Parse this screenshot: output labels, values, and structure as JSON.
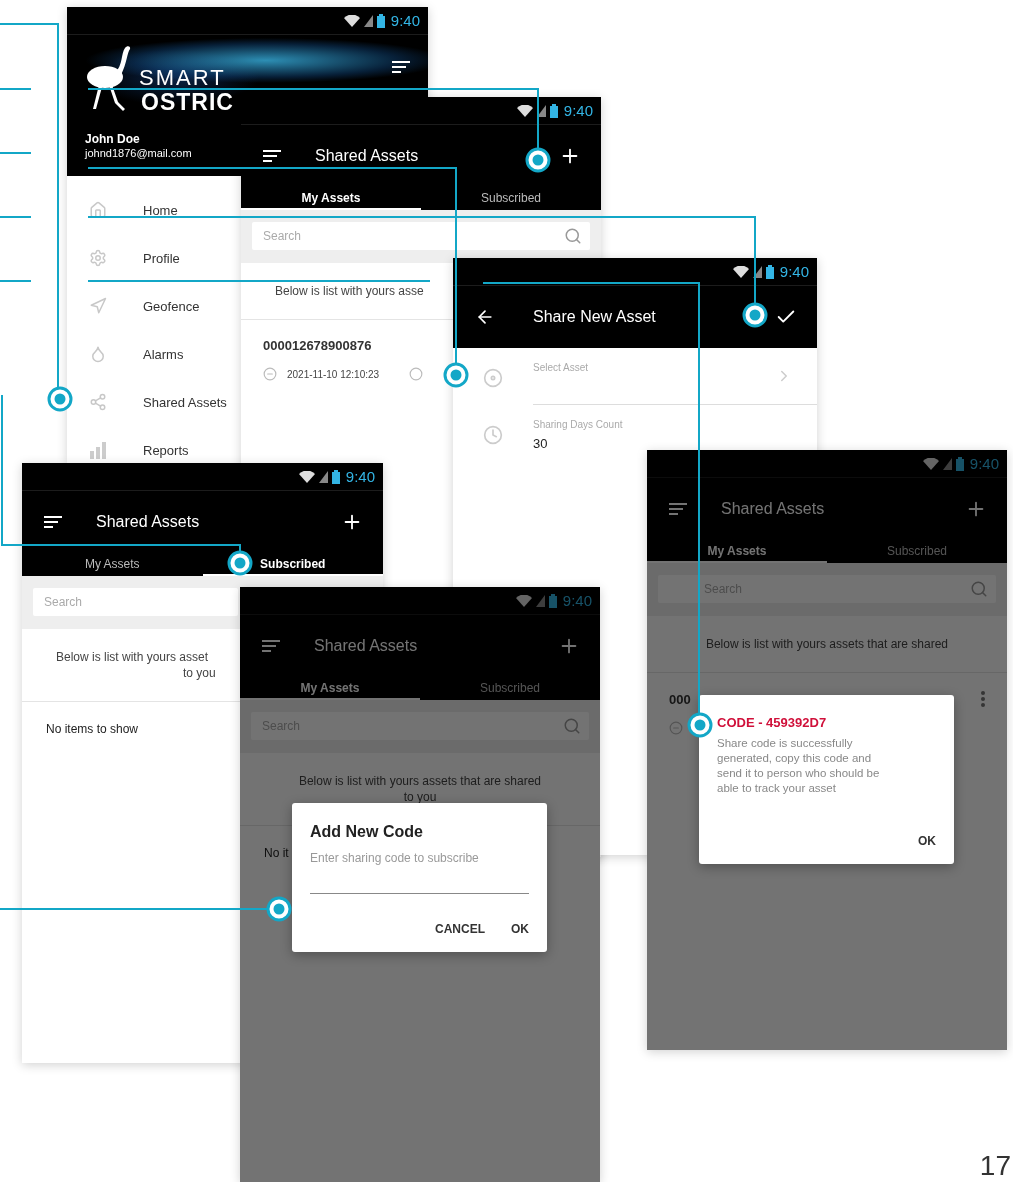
{
  "screens": [
    {
      "kind": "drawer",
      "status_time": "9:40",
      "logo": [
        "SMART",
        "OSTRIC"
      ],
      "user_name": "John Doe",
      "user_email": "johnd1876@mail.com",
      "menu": [
        {
          "label": "Home"
        },
        {
          "label": "Profile"
        },
        {
          "label": "Geofence"
        },
        {
          "label": "Alarms"
        },
        {
          "label": "Shared Assets"
        },
        {
          "label": "Reports"
        }
      ]
    },
    {
      "kind": "list",
      "dimmed": false,
      "status_time": "9:40",
      "title": "Shared Assets",
      "tabs": [
        {
          "label": "My Assets",
          "selected": true
        },
        {
          "label": "Subscribed",
          "selected": false
        }
      ],
      "search": {
        "placeholder": "Search"
      },
      "info": [
        "Below is list with yours asse"
      ],
      "items": [
        {
          "id": "000012678900876",
          "date": "2021-11-10 12:10:23",
          "menu": false
        }
      ]
    },
    {
      "kind": "form",
      "status_time": "9:40",
      "title": "Share New Asset",
      "fields": [
        {
          "kind": "select",
          "label": "Select Asset"
        },
        {
          "kind": "value",
          "label": "Sharing Days Count",
          "value": "30"
        }
      ]
    },
    {
      "kind": "list",
      "dimmed": false,
      "status_time": "9:40",
      "title": "Shared Assets",
      "tabs": [
        {
          "label": "My Assets",
          "selected": false
        },
        {
          "label": "Subscribed",
          "selected": true
        }
      ],
      "search": {
        "placeholder": "Search"
      },
      "info": [
        "Below is list with yours asset",
        "to you"
      ],
      "empty": "No items to show"
    },
    {
      "kind": "list",
      "dimmed": true,
      "status_time": "9:40",
      "title": "Shared Assets",
      "tabs": [
        {
          "label": "My Assets",
          "selected": true
        },
        {
          "label": "Subscribed",
          "selected": false
        }
      ],
      "search": {
        "placeholder": "Search"
      },
      "info": [
        "Below is list with yours assets that are shared",
        "to you"
      ],
      "empty": "No it",
      "dialog": {
        "kind": "input",
        "title": "Add New Code",
        "placeholder": "Enter sharing code to subscribe",
        "buttons": [
          "CANCEL",
          "OK"
        ]
      }
    },
    {
      "kind": "list",
      "dimmed": true,
      "status_time": "9:40",
      "title": "Shared Assets",
      "tabs": [
        {
          "label": "My Assets",
          "selected": true
        },
        {
          "label": "Subscribed",
          "selected": false
        }
      ],
      "search": {
        "placeholder": "Search"
      },
      "info": [
        "Below is list with yours assets that are shared"
      ],
      "items": [
        {
          "id": "000",
          "menu": true
        }
      ],
      "dialog": {
        "kind": "message",
        "title": "CODE - 459392D7",
        "message": "Share code is successfully generated, copy this code and send it to person who should be able to track your asset",
        "buttons": [
          "OK"
        ]
      }
    }
  ],
  "page_number": "17"
}
